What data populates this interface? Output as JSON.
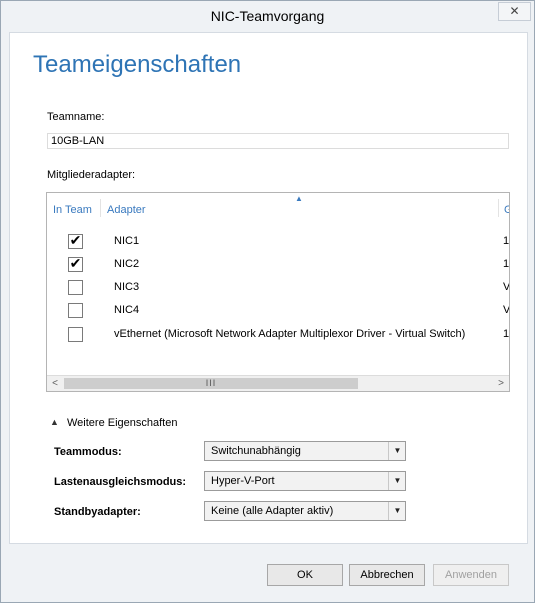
{
  "window": {
    "title": "NIC-Teamvorgang",
    "close_glyph": "✕"
  },
  "page_title": "Teameigenschaften",
  "teamname": {
    "label": "Teamname:",
    "value": "10GB-LAN"
  },
  "members": {
    "label": "Mitgliederadapter:",
    "sort_indicator": "▲",
    "columns": [
      "In Team",
      "Adapter",
      "G"
    ],
    "rows": [
      {
        "checked": true,
        "adapter": "NIC1",
        "extra": "1"
      },
      {
        "checked": true,
        "adapter": "NIC2",
        "extra": "1"
      },
      {
        "checked": false,
        "adapter": "NIC3",
        "extra": "V"
      },
      {
        "checked": false,
        "adapter": "NIC4",
        "extra": "V"
      },
      {
        "checked": false,
        "adapter": "vEthernet (Microsoft Network Adapter Multiplexor Driver - Virtual Switch)",
        "extra": "1"
      }
    ],
    "scroll_left": "<",
    "scroll_right": ">",
    "scroll_grip": "III"
  },
  "more_props": {
    "arrow": "▲",
    "label": "Weitere Eigenschaften"
  },
  "properties": [
    {
      "label": "Teammodus:",
      "value": "Switchunabhängig"
    },
    {
      "label": "Lastenausgleichsmodus:",
      "value": "Hyper-V-Port"
    },
    {
      "label": "Standbyadapter:",
      "value": "Keine (alle Adapter aktiv)"
    }
  ],
  "dropdown_glyph": "▼",
  "check_glyph": "✔",
  "buttons": {
    "ok": "OK",
    "cancel": "Abbrechen",
    "apply": "Anwenden"
  }
}
